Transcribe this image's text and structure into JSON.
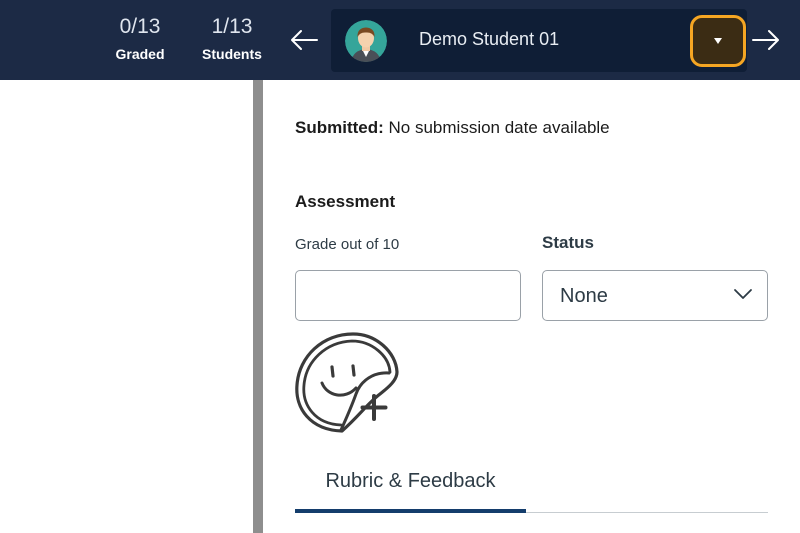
{
  "header": {
    "graded": {
      "count": "0/13",
      "label": "Graded"
    },
    "students": {
      "count": "1/13",
      "label": "Students"
    },
    "prev_icon": "arrow-left-icon",
    "next_icon": "arrow-right-icon",
    "student_name": "Demo Student 01",
    "dropdown_icon": "caret-down-icon"
  },
  "submission": {
    "label": "Submitted:",
    "value": "No submission date available"
  },
  "assessment": {
    "heading": "Assessment",
    "grade_label": "Grade out of 10",
    "grade_value": "",
    "status_label": "Status",
    "status_value": "None"
  },
  "sticker": {
    "icon": "sticker-add-icon"
  },
  "tabs": [
    {
      "label": "Rubric & Feedback",
      "active": true
    }
  ],
  "colors": {
    "header_bg": "#1c2a45",
    "student_box_bg": "#0f1e36",
    "focus_ring": "#f5a623",
    "tab_underline": "#143d6c",
    "divider": "#8e8e8e"
  }
}
